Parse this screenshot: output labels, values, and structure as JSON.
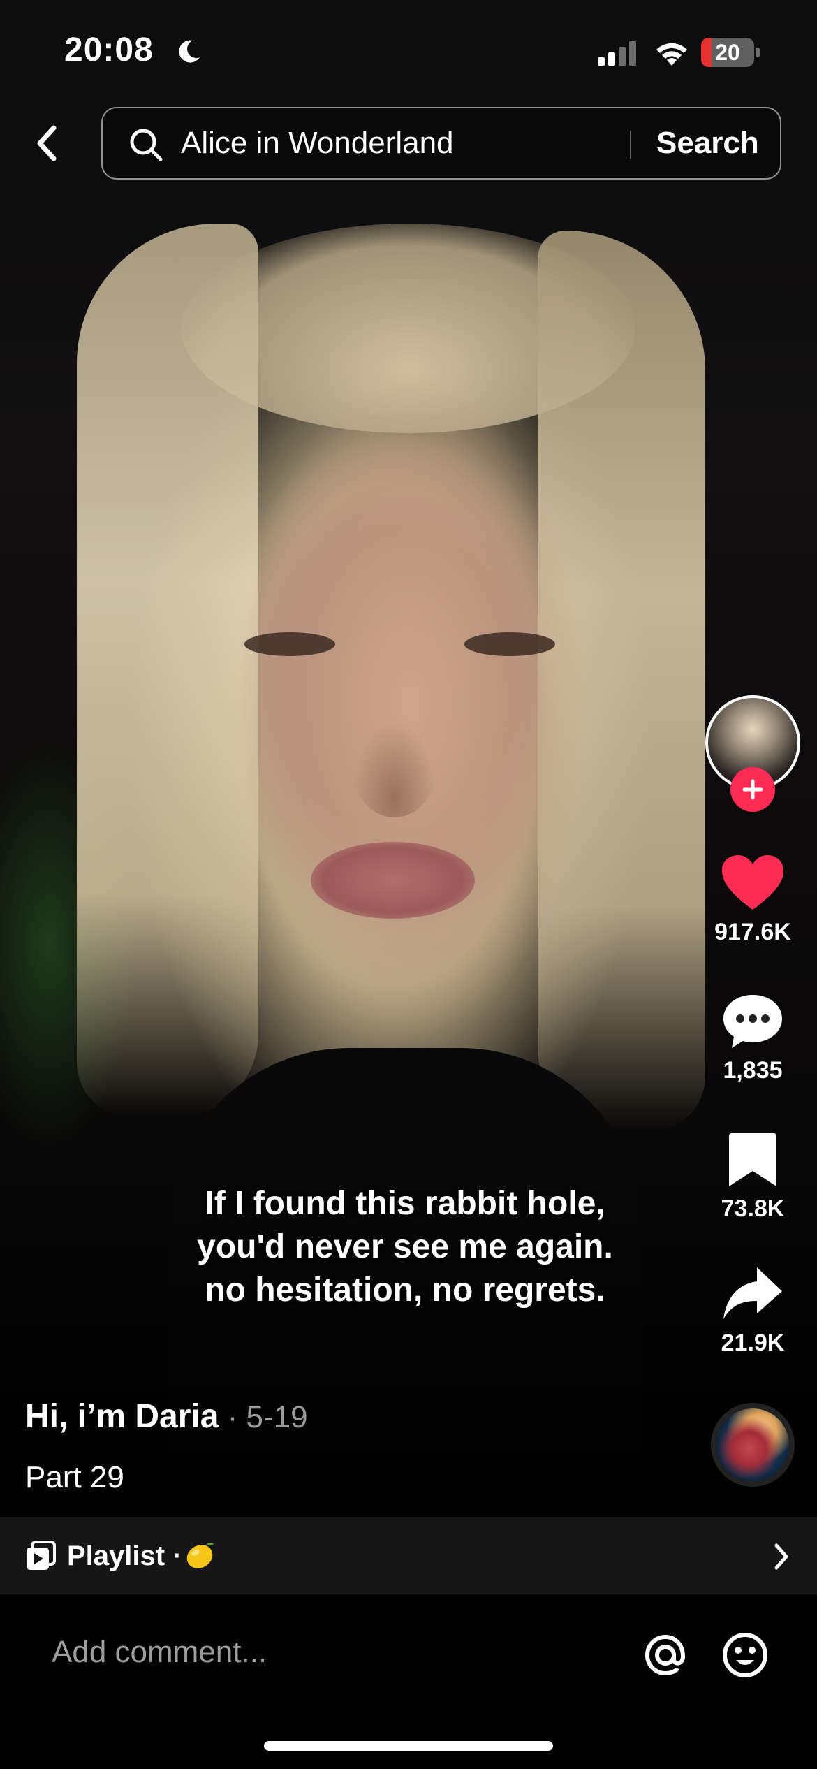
{
  "status_bar": {
    "time": "20:08",
    "battery_level": "20",
    "battery_fraction": 0.2,
    "battery_color": "#e5312f",
    "icons": [
      "moon-icon",
      "signal-icon",
      "wifi-icon",
      "battery-icon"
    ]
  },
  "search": {
    "query": "Alice in Wonderland",
    "button_label": "Search"
  },
  "rail": {
    "like_count": "917.6K",
    "comment_count": "1,835",
    "save_count": "73.8K",
    "share_count": "21.9K",
    "like_color": "#fe2c55",
    "follow_color": "#fe2c55"
  },
  "video": {
    "caption": "If I found this rabbit hole,\nyou'd never see me again.\n no hesitation, no regrets."
  },
  "post": {
    "author": "Hi, i’m Daria",
    "date": " · 5-19",
    "description": "Part 29"
  },
  "playlist": {
    "label": "Playlist ·"
  },
  "comment": {
    "placeholder": "Add comment..."
  }
}
